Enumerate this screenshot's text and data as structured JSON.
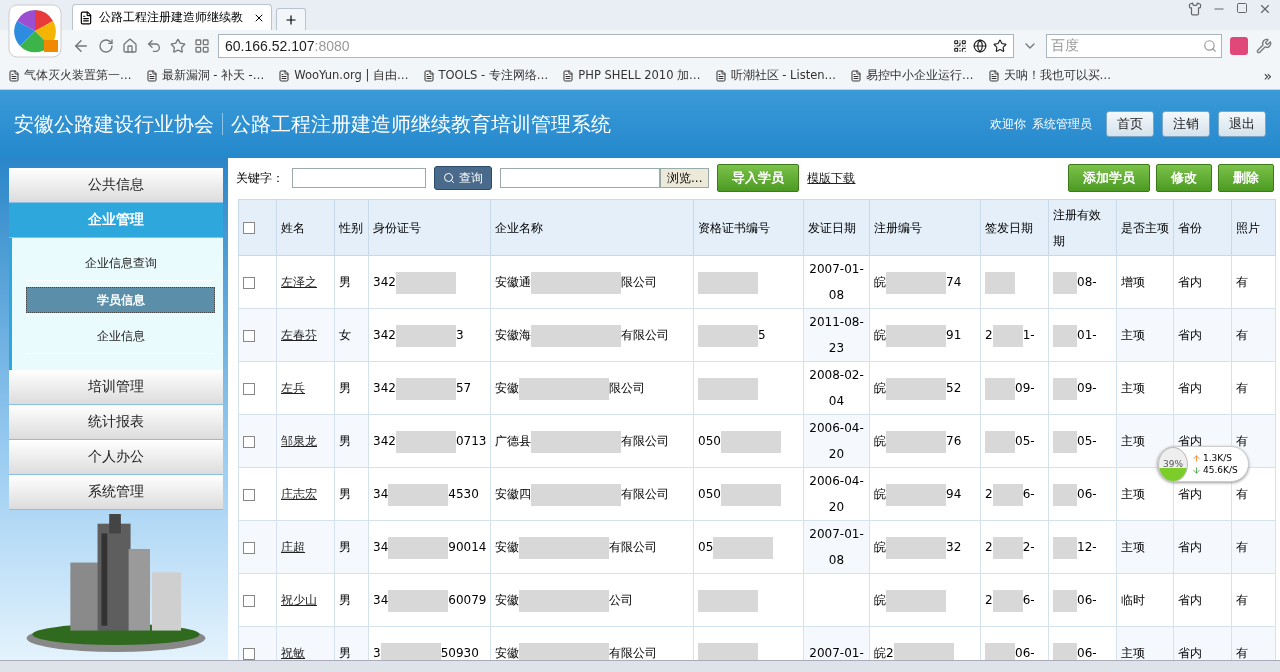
{
  "browser": {
    "tab_title": "公路工程注册建造师继续教",
    "address_host": "60.166.52.107",
    "address_port": ":8080",
    "search_placeholder": "百度",
    "bookmarks": [
      "气体灭火装置第一…",
      "最新漏洞 - 补天 -…",
      "WooYun.org | 自由…",
      "TOOLS - 专注网络…",
      "PHP SHELL 2010 加…",
      "听潮社区 - Listen…",
      "易控中小企业运行…",
      "天呐！我也可以买…"
    ],
    "more": "»"
  },
  "header": {
    "org": "安徽公路建设行业协会",
    "system": "公路工程注册建造师继续教育培训管理系统",
    "welcome": "欢迎你",
    "user": "系统管理员",
    "buttons": [
      "首页",
      "注销",
      "退出"
    ]
  },
  "sidebar": {
    "groups": [
      {
        "label": "公共信息",
        "expanded": false
      },
      {
        "label": "企业管理",
        "expanded": true,
        "children": [
          {
            "label": "企业信息查询",
            "selected": false
          },
          {
            "label": "学员信息",
            "selected": true
          },
          {
            "label": "企业信息",
            "selected": false
          }
        ]
      },
      {
        "label": "培训管理",
        "expanded": false
      },
      {
        "label": "统计报表",
        "expanded": false
      },
      {
        "label": "个人办公",
        "expanded": false
      },
      {
        "label": "系统管理",
        "expanded": false
      }
    ]
  },
  "toolbar": {
    "keyword_label": "关键字：",
    "search_button": "查询",
    "browse_button": "浏览...",
    "import_button": "导入学员",
    "template_link": "模版下载",
    "actions": [
      "添加学员",
      "修改",
      "删除"
    ]
  },
  "table": {
    "select_all_checked": false,
    "columns": [
      "姓名",
      "性别",
      "身份证号",
      "企业名称",
      "资格证书编号",
      "发证日期",
      "注册编号",
      "签发日期",
      "注册有效期",
      "是否主项",
      "省份",
      "照片"
    ],
    "rows": [
      {
        "checked": false,
        "name": "左泽之",
        "sex": "男",
        "id": {
          "start": "342"
        },
        "company": {
          "start": "安徽通",
          "end": "限公司"
        },
        "issued": "2007-01-08",
        "reg": {
          "start": "皖",
          "end": "74"
        },
        "valid": {
          "end": "08-"
        },
        "main": "增项",
        "province": "省内",
        "photo": "有"
      },
      {
        "checked": false,
        "name": "左春芬",
        "sex": "女",
        "id": {
          "start": "342",
          "end": "3"
        },
        "company": {
          "start": "安徽海",
          "end": "有限公司"
        },
        "cert": {
          "end": "5"
        },
        "issued": "2011-08-23",
        "reg": {
          "start": "皖",
          "end": "91"
        },
        "signed": {
          "start": "2",
          "end": "1-"
        },
        "valid": {
          "end": "01-"
        },
        "main": "主项",
        "province": "省内",
        "photo": "有"
      },
      {
        "checked": false,
        "name": "左兵",
        "sex": "男",
        "id": {
          "start": "342",
          "end": "57"
        },
        "company": {
          "start": "安徽",
          "end": "限公司"
        },
        "issued": "2008-02-04",
        "reg": {
          "start": "皖",
          "end": "52"
        },
        "signed": {
          "end": "09-"
        },
        "valid": {
          "end": "09-"
        },
        "main": "主项",
        "province": "省内",
        "photo": "有"
      },
      {
        "checked": false,
        "name": "邹泉龙",
        "sex": "男",
        "id": {
          "start": "342",
          "end": "0713"
        },
        "company": {
          "start": "广德县",
          "end": "有限公司"
        },
        "cert": {
          "start": "050"
        },
        "issued": "2006-04-20",
        "reg": {
          "start": "皖",
          "end": "76"
        },
        "signed": {
          "end": "05-"
        },
        "valid": {
          "end": "05-"
        },
        "main": "主项",
        "province": "省内",
        "photo": "有"
      },
      {
        "checked": false,
        "name": "庄志宏",
        "sex": "男",
        "id": {
          "start": "34",
          "end": "4530"
        },
        "company": {
          "start": "安徽四",
          "end": "有限公司"
        },
        "cert": {
          "start": "050"
        },
        "issued": "2006-04-20",
        "reg": {
          "start": "皖",
          "end": "94"
        },
        "signed": {
          "start": "2",
          "end": "6-"
        },
        "valid": {
          "end": "06-"
        },
        "main": "主项",
        "province": "省内",
        "photo": "有"
      },
      {
        "checked": false,
        "name": "庄超",
        "sex": "男",
        "id": {
          "start": "34",
          "end": "90014"
        },
        "company": {
          "start": "安徽",
          "end": "有限公司"
        },
        "cert": {
          "start": "05"
        },
        "issued": "2007-01-08",
        "reg": {
          "start": "皖",
          "end": "32"
        },
        "signed": {
          "start": "2",
          "end": "2-"
        },
        "valid": {
          "end": "12-"
        },
        "main": "主项",
        "province": "省内",
        "photo": "有"
      },
      {
        "checked": false,
        "name": "祝少山",
        "sex": "男",
        "id": {
          "start": "34",
          "end": "60079"
        },
        "company": {
          "start": "安徽",
          "end": "公司"
        },
        "reg": {
          "start": "皖"
        },
        "signed": {
          "start": "2",
          "end": "6-"
        },
        "valid": {
          "end": "06-"
        },
        "main": "临时",
        "province": "省内",
        "photo": "有"
      },
      {
        "checked": false,
        "name": "祝敏",
        "sex": "男",
        "id": {
          "start": "3",
          "end": "50930"
        },
        "company": {
          "start": "安徽",
          "end": "有限公司"
        },
        "issued": "2007-01-",
        "reg": {
          "start": "皖2"
        },
        "signed": {
          "end": "06-"
        },
        "valid": {
          "end": "06-"
        },
        "main": "主项",
        "province": "省内",
        "photo": "有"
      }
    ]
  },
  "net_meter": {
    "percent": "39%",
    "level": 0.39,
    "upload": "1.3K/S",
    "download": "45.6K/S"
  }
}
